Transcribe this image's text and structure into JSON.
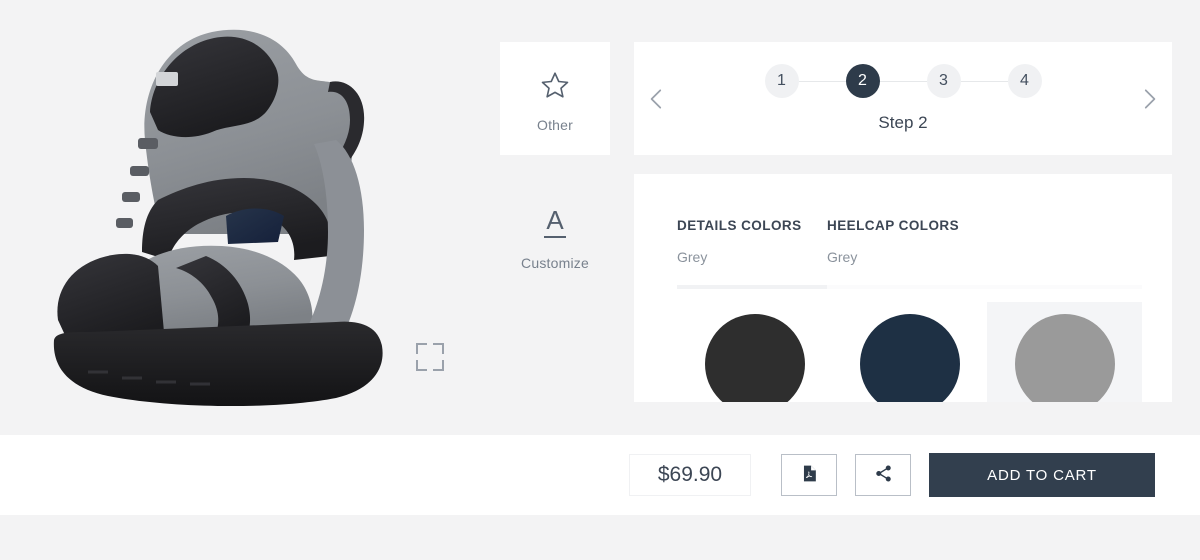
{
  "theme": {
    "page_background": "#f3f3f4",
    "card_background": "#ffffff",
    "accent_dark": "#2e3b4a",
    "button_dark": "#323f4e",
    "muted_text": "#8a929c"
  },
  "product_viewer": {
    "fullscreen_icon": "fullscreen-expand-icon",
    "product_name": "hiking boot rear view",
    "colors": {
      "mesh_grey": "#8f9398",
      "overlay_black": "#2b2b2d",
      "accent_navy": "#1e2c40",
      "sole_black": "#1a1a1c"
    }
  },
  "tool_rail": {
    "items": [
      {
        "label": "Other",
        "icon": "star-icon",
        "active": true
      },
      {
        "label": "Customize",
        "icon": "underlined-a-icon",
        "active": false
      }
    ]
  },
  "stepper": {
    "prev_icon": "chevron-left-icon",
    "next_icon": "chevron-right-icon",
    "steps": [
      {
        "number": "1",
        "current": false
      },
      {
        "number": "2",
        "current": true
      },
      {
        "number": "3",
        "current": false
      },
      {
        "number": "4",
        "current": false
      }
    ],
    "caption": "Step 2"
  },
  "options": {
    "tabs": [
      {
        "title": "DETAILS COLORS",
        "value": "Grey",
        "active": true
      },
      {
        "title": "HEELCAP COLORS",
        "value": "Grey",
        "active": false
      }
    ],
    "swatches": [
      {
        "name": "Black",
        "color": "#2e2e2e",
        "selected": false
      },
      {
        "name": "Navy",
        "color": "#1e3044",
        "selected": false
      },
      {
        "name": "Grey",
        "color": "#9a9a9a",
        "selected": true
      }
    ]
  },
  "bottom_bar": {
    "price": "$69.90",
    "pdf_icon": "pdf-document-icon",
    "share_icon": "share-icon",
    "add_to_cart_label": "ADD TO CART"
  }
}
